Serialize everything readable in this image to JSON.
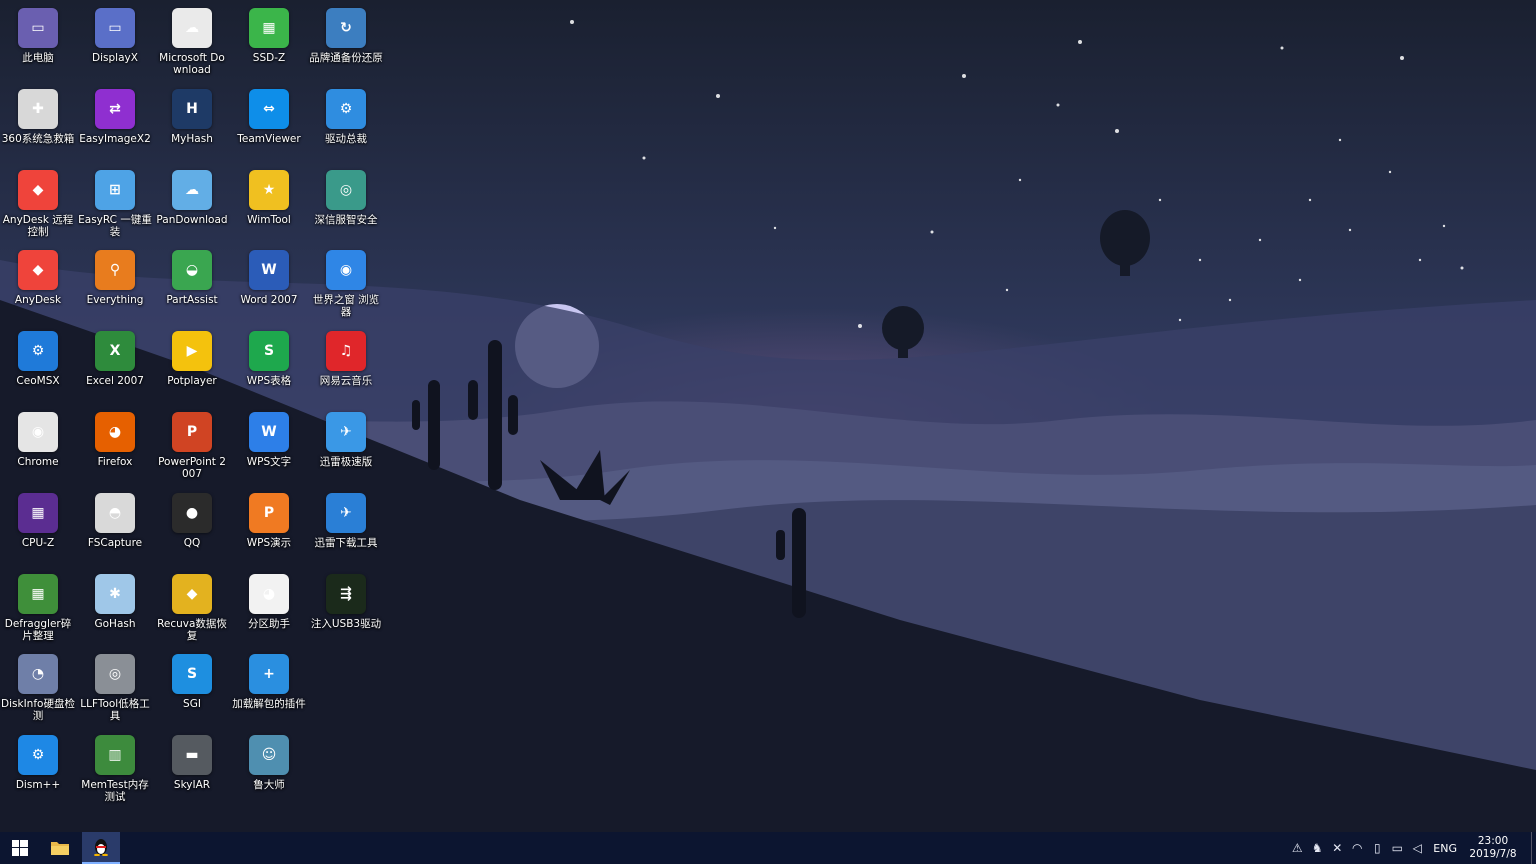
{
  "desktop": {
    "columns": [
      [
        {
          "label": "此电脑",
          "icon": "this-pc-icon",
          "color": "#6a5fb0",
          "glyph": "▭"
        },
        {
          "label": "360系统急救箱",
          "icon": "first-aid-kit-icon",
          "color": "#d8d8d8",
          "glyph": "✚"
        },
        {
          "label": "AnyDesk 远程控制",
          "icon": "anydesk-icon",
          "color": "#ef443b",
          "glyph": "◆"
        },
        {
          "label": "AnyDesk",
          "icon": "anydesk-icon",
          "color": "#ef443b",
          "glyph": "◆"
        },
        {
          "label": "CeoMSX",
          "icon": "ceomsx-icon",
          "color": "#1f7ad9",
          "glyph": "⚙"
        },
        {
          "label": "Chrome",
          "icon": "chrome-icon",
          "color": "#e5e5e5",
          "glyph": "◉"
        },
        {
          "label": "CPU-Z",
          "icon": "cpu-z-icon",
          "color": "#5b2d91",
          "glyph": "▦"
        },
        {
          "label": "Defraggler碎片整理",
          "icon": "defraggler-icon",
          "color": "#3f8f3a",
          "glyph": "▦"
        },
        {
          "label": "DiskInfo硬盘检测",
          "icon": "diskinfo-icon",
          "color": "#6f7fa8",
          "glyph": "◔"
        },
        {
          "label": "Dism++",
          "icon": "dism-icon",
          "color": "#1e88e5",
          "glyph": "⚙"
        }
      ],
      [
        {
          "label": "DisplayX",
          "icon": "displayx-icon",
          "color": "#5a6fc8",
          "glyph": "▭"
        },
        {
          "label": "EasyImageX2",
          "icon": "easyimagex-icon",
          "color": "#8f2fd0",
          "glyph": "⇄"
        },
        {
          "label": "EasyRC 一键重装",
          "icon": "easyrc-icon",
          "color": "#4ea3e6",
          "glyph": "⊞"
        },
        {
          "label": "Everything",
          "icon": "everything-icon",
          "color": "#e87c1e",
          "glyph": "⚲"
        },
        {
          "label": "Excel 2007",
          "icon": "excel-icon",
          "color": "#2e8b3c",
          "glyph": "X"
        },
        {
          "label": "Firefox",
          "icon": "firefox-icon",
          "color": "#e66000",
          "glyph": "◕"
        },
        {
          "label": "FSCapture",
          "icon": "fscapture-icon",
          "color": "#d9d9d9",
          "glyph": "◓"
        },
        {
          "label": "GoHash",
          "icon": "gohash-icon",
          "color": "#9fc7e8",
          "glyph": "✱"
        },
        {
          "label": "LLFTool低格工具",
          "icon": "llftool-icon",
          "color": "#8a8f96",
          "glyph": "◎"
        },
        {
          "label": "MemTest内存测试",
          "icon": "memtest-icon",
          "color": "#3d8b3d",
          "glyph": "▥"
        }
      ],
      [
        {
          "label": "Microsoft Download",
          "icon": "cloud-download-icon",
          "color": "#eaeaea",
          "glyph": "☁"
        },
        {
          "label": "MyHash",
          "icon": "myhash-icon",
          "color": "#1e3a66",
          "glyph": "H"
        },
        {
          "label": "PanDownload",
          "icon": "pandownload-icon",
          "color": "#62aee6",
          "glyph": "☁"
        },
        {
          "label": "PartAssist",
          "icon": "partassist-icon",
          "color": "#3aa650",
          "glyph": "◒"
        },
        {
          "label": "Potplayer",
          "icon": "potplayer-icon",
          "color": "#f4c20d",
          "glyph": "▶"
        },
        {
          "label": "PowerPoint 2007",
          "icon": "powerpoint-icon",
          "color": "#d04423",
          "glyph": "P"
        },
        {
          "label": "QQ",
          "icon": "qq-icon",
          "color": "#2b2b2b",
          "glyph": "●"
        },
        {
          "label": "Recuva数据恢复",
          "icon": "recuva-icon",
          "color": "#e3b21f",
          "glyph": "◆"
        },
        {
          "label": "SGI",
          "icon": "sgi-icon",
          "color": "#1e8fe0",
          "glyph": "S"
        },
        {
          "label": "SkyIAR",
          "icon": "skyiar-icon",
          "color": "#555a60",
          "glyph": "▬"
        }
      ],
      [
        {
          "label": "SSD-Z",
          "icon": "ssd-z-icon",
          "color": "#3bb54a",
          "glyph": "▦"
        },
        {
          "label": "TeamViewer",
          "icon": "teamviewer-icon",
          "color": "#0e8ee9",
          "glyph": "⇔"
        },
        {
          "label": "WimTool",
          "icon": "wimtool-icon",
          "color": "#f0c020",
          "glyph": "★"
        },
        {
          "label": "Word 2007",
          "icon": "word-icon",
          "color": "#2b5cb8",
          "glyph": "W"
        },
        {
          "label": "WPS表格",
          "icon": "wps-spreadsheet-icon",
          "color": "#1ea84d",
          "glyph": "S"
        },
        {
          "label": "WPS文字",
          "icon": "wps-writer-icon",
          "color": "#2d7fe8",
          "glyph": "W"
        },
        {
          "label": "WPS演示",
          "icon": "wps-presentation-icon",
          "color": "#f07a22",
          "glyph": "P"
        },
        {
          "label": "分区助手",
          "icon": "partition-assistant-icon",
          "color": "#f2f2f2",
          "glyph": "◕"
        },
        {
          "label": "加载解包的插件",
          "icon": "plugin-loader-icon",
          "color": "#2a8fe0",
          "glyph": "+"
        },
        {
          "label": "鲁大师",
          "icon": "ludashi-icon",
          "color": "#4f8fb0",
          "glyph": "☺"
        }
      ],
      [
        {
          "label": "品牌通备份还原",
          "icon": "backup-restore-icon",
          "color": "#3c7ec0",
          "glyph": "↻"
        },
        {
          "label": "驱动总裁",
          "icon": "driver-tool-icon",
          "color": "#2f8de0",
          "glyph": "⚙"
        },
        {
          "label": "深信服智安全",
          "icon": "sangfor-security-icon",
          "color": "#3a9a8a",
          "glyph": "◎"
        },
        {
          "label": "世界之窗 浏览器",
          "icon": "theworld-browser-icon",
          "color": "#2f86e6",
          "glyph": "◉"
        },
        {
          "label": "网易云音乐",
          "icon": "netease-music-icon",
          "color": "#e0262a",
          "glyph": "♫"
        },
        {
          "label": "迅雷极速版",
          "icon": "thunder-speed-icon",
          "color": "#3a98e6",
          "glyph": "✈"
        },
        {
          "label": "迅雷下载工具",
          "icon": "thunder-download-icon",
          "color": "#2a7fd6",
          "glyph": "✈"
        },
        {
          "label": "注入USB3驱动",
          "icon": "usb-icon",
          "color": "#1b2a1b",
          "glyph": "⇶"
        }
      ]
    ]
  },
  "taskbar": {
    "lang": "ENG",
    "time": "23:00",
    "date": "2019/7/8"
  }
}
